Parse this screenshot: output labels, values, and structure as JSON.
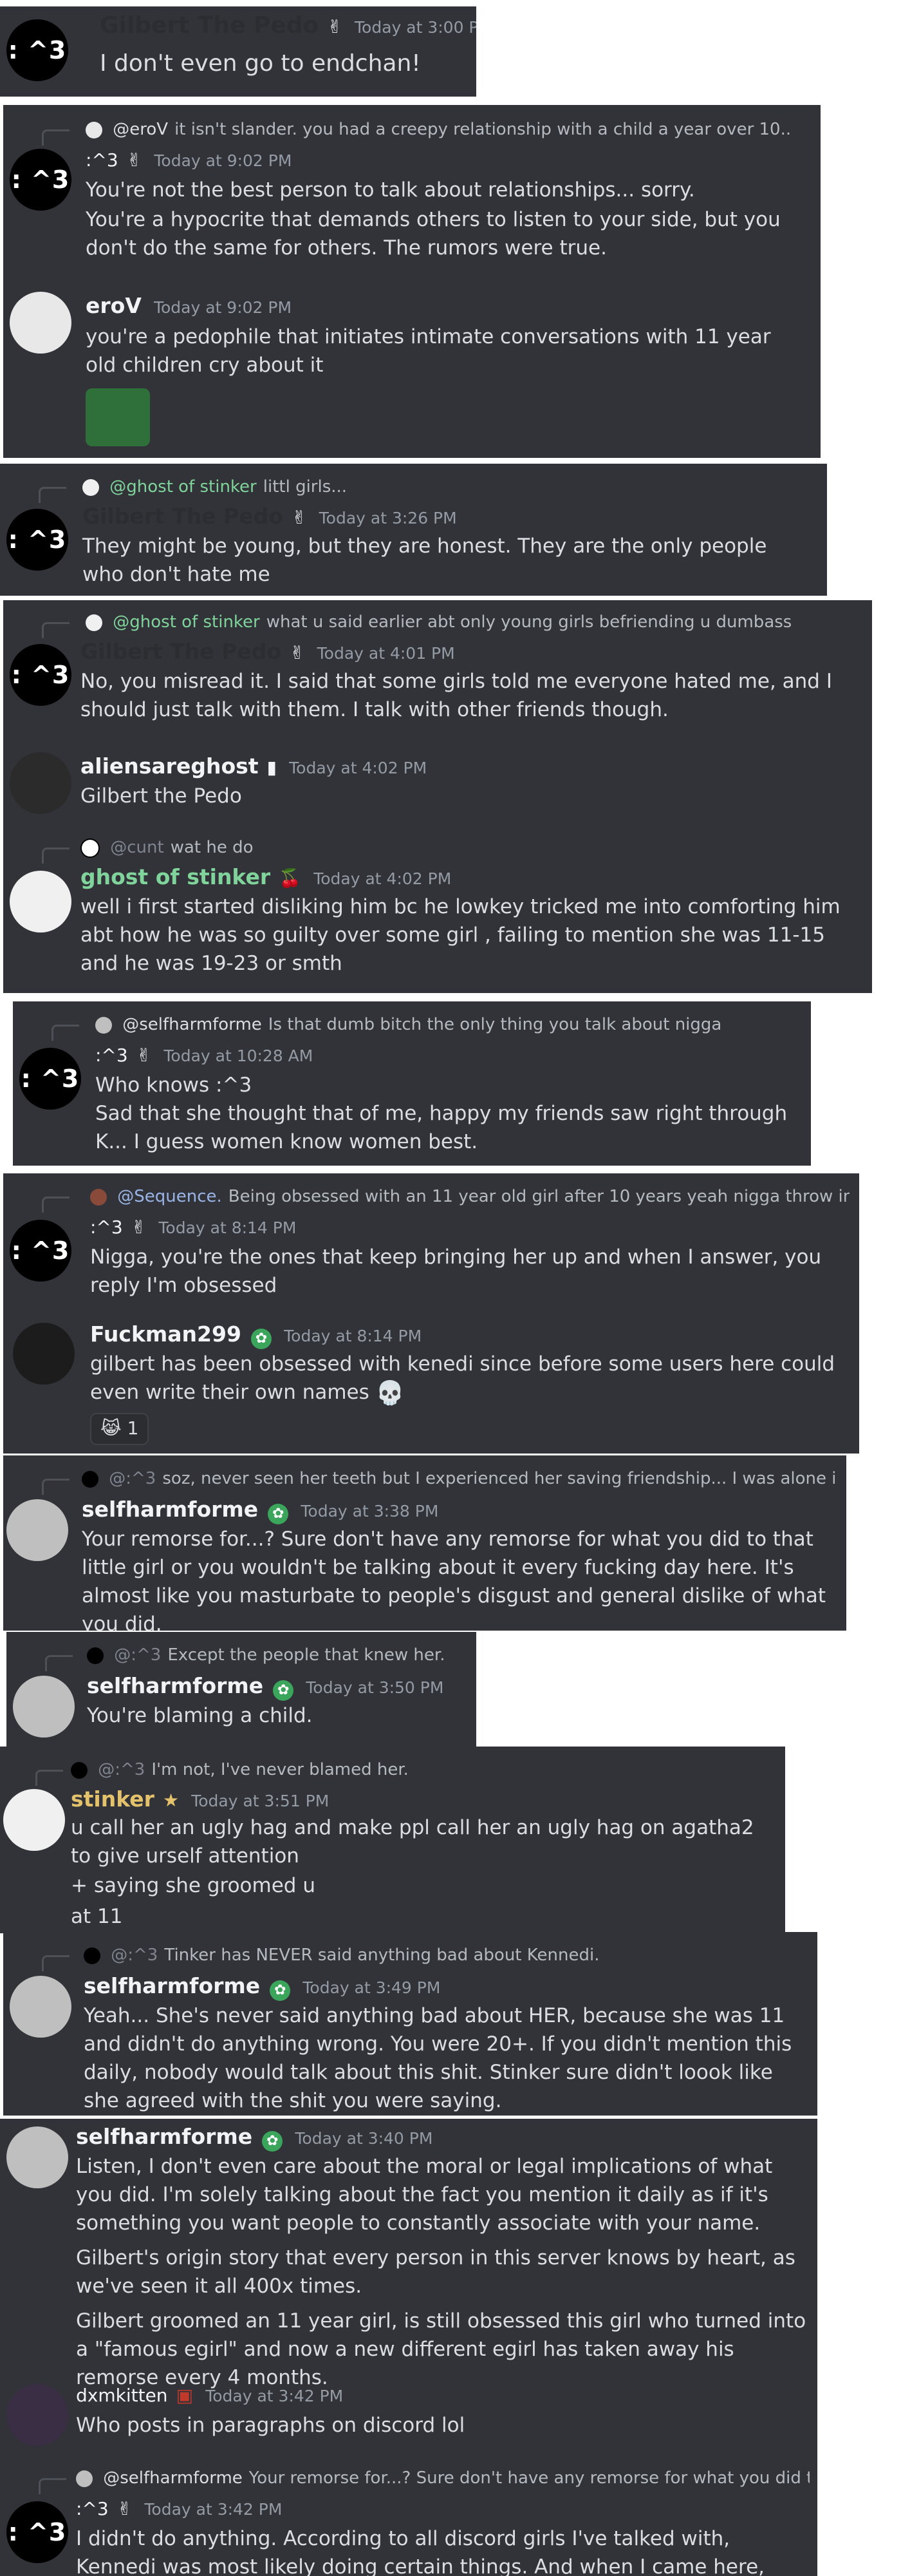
{
  "panel1": {
    "username": "Gilbert The Pedo",
    "timestamp": "Today at 3:00 PM",
    "text": "I don't even go to endchan!",
    "avatar_text": ": ^3",
    "badge_icon": "hand-sign-icon"
  },
  "panel2": {
    "reply": {
      "name": "@eroV",
      "text": "it isn't slander. you had a creepy relationship with a child a year over 10.."
    },
    "m1": {
      "username": ":^3",
      "timestamp": "Today at 9:02 PM",
      "avatar_text": ": ^3",
      "lines": [
        "You're not the best person to talk about relationships... sorry.",
        "You're a hypocrite that demands others to listen to your side, but you don't do the same for others. The rumors were true."
      ]
    },
    "m2": {
      "username": "eroV",
      "timestamp": "Today at 9:02 PM",
      "text": "you're a pedophile that initiates intimate conversations with 11 year old children cry about it"
    }
  },
  "panel3": {
    "reply": {
      "name": "@ghost of stinker",
      "text": "littl girls..."
    },
    "username": "Gilbert The Pedo",
    "timestamp": "Today at 3:26 PM",
    "avatar_text": ": ^3",
    "text": "They might be young, but they are honest. They are the only people who don't hate me"
  },
  "panel4": {
    "reply": {
      "name": "@ghost of stinker",
      "text": "what u said earlier abt only young girls befriending u dumbass"
    },
    "m1": {
      "username": "Gilbert The Pedo",
      "timestamp": "Today at 4:01 PM",
      "avatar_text": ": ^3",
      "text": "No, you misread it. I said that some girls told me everyone hated me, and I should just talk with them. I talk with other friends though."
    },
    "m2": {
      "username": "aliensareghost",
      "timestamp": "Today at 4:02 PM",
      "text": "Gilbert the Pedo"
    },
    "m3": {
      "reply": {
        "name": "@cunt",
        "text": "wat he do"
      },
      "username": "ghost of stinker",
      "timestamp": "Today at 4:02 PM",
      "text": "well i first started disliking him bc he lowkey tricked me into comforting him abt how he was so guilty over some girl , failing to mention she was 11-15 and he was 19-23 or smth"
    }
  },
  "panel5": {
    "reply": {
      "name": "@selfharmforme",
      "text": "Is that dumb bitch the only thing you talk about nigga"
    },
    "username": ":^3",
    "timestamp": "Today at 10:28 AM",
    "avatar_text": ": ^3",
    "lines": [
      "Who knows :^3",
      "Sad that she thought that of me, happy my friends saw right through K... I guess women know women best."
    ]
  },
  "panel6": {
    "reply": {
      "name": "@Sequence.",
      "text": "Being obsessed with an 11 year old girl after 10 years yeah nigga throw in the towe"
    },
    "m1": {
      "username": ":^3",
      "timestamp": "Today at 8:14 PM",
      "avatar_text": ": ^3",
      "text": "Nigga, you're the ones that keep bringing her up and when I answer, you reply I'm obsessed"
    },
    "m2": {
      "username": "Fuckman299",
      "timestamp": "Today at 8:14 PM",
      "text": "gilbert has been obsessed with kenedi since before some users here could even write their own names",
      "reaction_count": "1"
    }
  },
  "panel7": {
    "reply": {
      "name": "@:^3",
      "text": "soz, never seen her teeth but I experienced her saving friendship... I was alone in remors"
    },
    "username": "selfharmforme",
    "timestamp": "Today at 3:38 PM",
    "text": "Your remorse for...? Sure don't have any remorse for what you did to that little girl or you wouldn't be talking about it every fucking day here. It's almost like you masturbate to people's disgust and general dislike of what you did."
  },
  "panel8": {
    "reply": {
      "name": "@:^3",
      "text": "Except the people that knew her."
    },
    "username": "selfharmforme",
    "timestamp": "Today at 3:50 PM",
    "text": "You're blaming a child."
  },
  "panel9": {
    "reply": {
      "name": "@:^3",
      "text": "I'm not, I've never blamed her."
    },
    "username": "stinker",
    "timestamp": "Today at 3:51 PM",
    "lines": [
      "u call her an ugly hag and make ppl call her an ugly hag on agatha2 to give urself attention",
      "+ saying she groomed u",
      "at 11"
    ]
  },
  "panel10": {
    "reply": {
      "name": "@:^3",
      "text": "Tinker has NEVER said anything bad about Kennedi."
    },
    "username": "selfharmforme",
    "timestamp": "Today at 3:49 PM",
    "text": "Yeah... She's never said anything bad about HER, because she was 11 and didn't do anything wrong. You were 20+. If you didn't mention this daily, nobody would talk about this shit.  Stinker sure didn't loook like she agreed with the shit you were saying."
  },
  "panel11": {
    "m1": {
      "username": "selfharmforme",
      "timestamp": "Today at 3:40 PM",
      "lines": [
        "Listen, I don't even care about the moral or legal implications of what you did. I'm solely talking about the fact you mention it daily as if it's something you want people to constantly associate with your name.",
        "Gilbert's origin story that every person in this server knows by heart, as we've seen it all 400x times.",
        "Gilbert groomed an 11 year girl, is still obsessed this girl who turned into a \"famous egirl\" and now a new different egirl has taken away his remorse every 4 months."
      ]
    },
    "m2": {
      "username": "dxmkitten",
      "timestamp": "Today at 3:42 PM",
      "text": "Who posts in paragraphs on discord lol"
    },
    "m3": {
      "reply": {
        "name": "@selfharmforme",
        "text": "Your remorse for...? Sure don't have any remorse for what you did to that litt"
      },
      "username": ":^3",
      "timestamp": "Today at 3:42 PM",
      "avatar_text": ": ^3",
      "text": "I didn't do anything. According to all discord girls I've talked with, Kennedi was most likely doing certain things. And when I came here, some people knew Kennedi"
    }
  },
  "colors": {
    "panel_bg": "#313338",
    "text": "#dbdee1",
    "muted": "#949ba4",
    "green_name": "#7fd39b",
    "yellow_name": "#e3c26b",
    "badge_green": "#3ba55c"
  },
  "icons": [
    "hand-sign-icon",
    "leaf-badge-icon",
    "cherry-icon",
    "skull-emoji-icon",
    "cat-reaction-icon",
    "frog-emoji-image"
  ]
}
